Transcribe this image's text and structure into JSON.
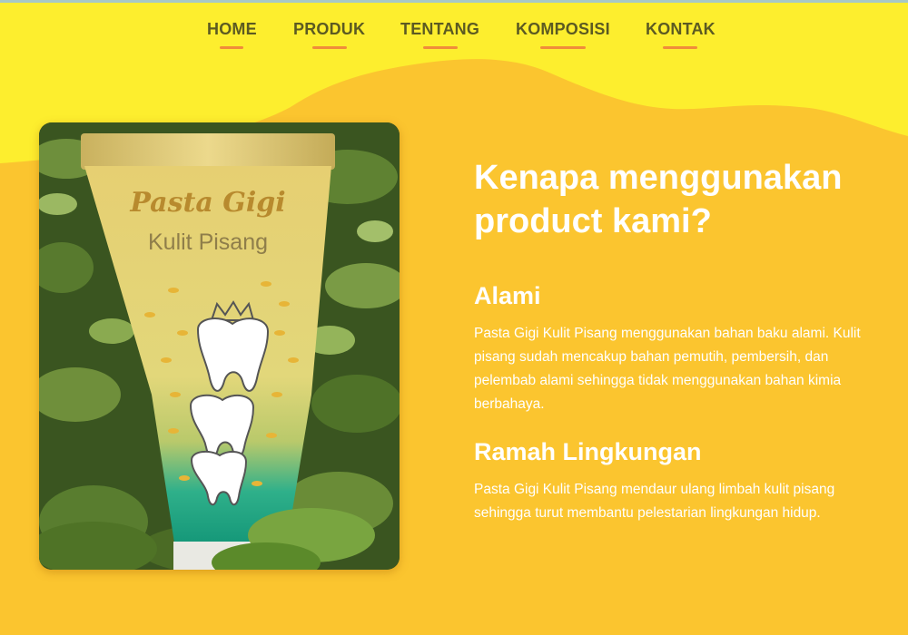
{
  "nav": {
    "items": [
      {
        "label": "HOME"
      },
      {
        "label": "PRODUK"
      },
      {
        "label": "TENTANG"
      },
      {
        "label": "KOMPOSISI"
      },
      {
        "label": "KONTAK"
      }
    ]
  },
  "product_image": {
    "brand_line1": "Pasta Gigi",
    "brand_line2": "Kulit Pisang"
  },
  "main": {
    "heading": "Kenapa menggunakan product kami?",
    "features": [
      {
        "title": "Alami",
        "text": "Pasta Gigi Kulit Pisang menggunakan bahan baku alami. Kulit pisang sudah mencakup bahan pemutih, pembersih, dan pelembab alami sehingga tidak menggunakan bahan kimia berbahaya."
      },
      {
        "title": "Ramah Lingkungan",
        "text": "Pasta Gigi Kulit Pisang mendaur ulang limbah kulit pisang sehingga turut membantu pelestarian lingkungan hidup."
      }
    ]
  },
  "colors": {
    "background": "#fbc52f",
    "wave": "#fdee2e",
    "nav_text": "#5c5a22",
    "nav_underline": "#f08c3a",
    "text": "#ffffff"
  }
}
